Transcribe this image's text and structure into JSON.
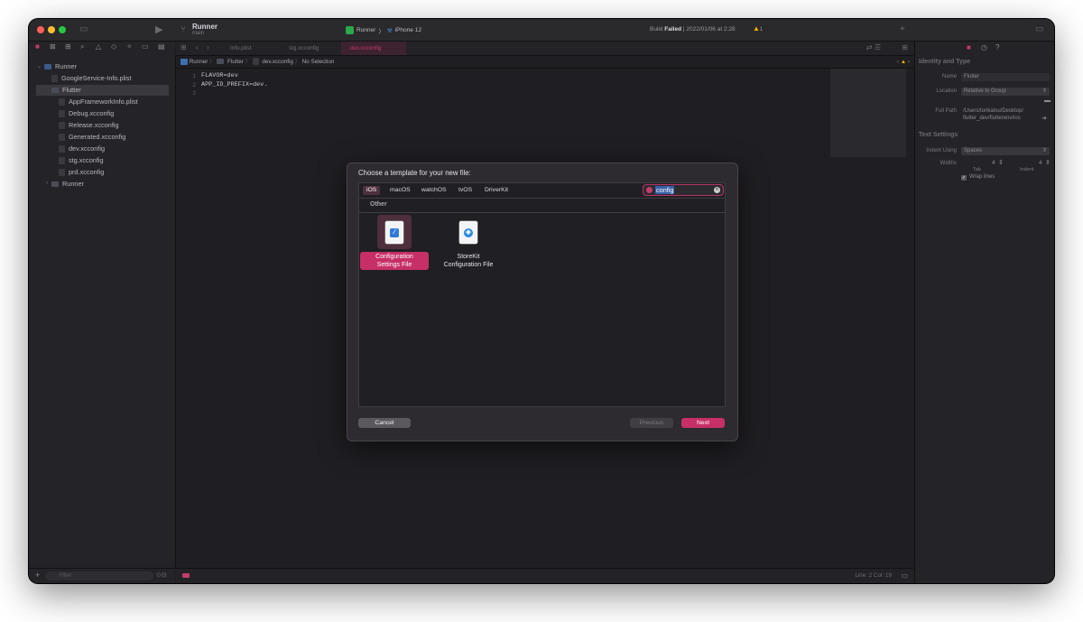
{
  "window": {
    "project_title": "Runner",
    "project_subtitle": "main",
    "scheme_target": "Runner",
    "device": "iPhone 12",
    "build_status_prefix": "Build",
    "build_status_bold": "Failed",
    "build_status_suffix": "| 2022/01/06 at 2:28",
    "warnings_count": "1"
  },
  "navigator": {
    "items": [
      {
        "label": "Runner",
        "kind": "project"
      },
      {
        "label": "GoogleService-Info.plist",
        "kind": "file"
      },
      {
        "label": "Flutter",
        "kind": "folder"
      },
      {
        "label": "AppFrameworkInfo.plist",
        "kind": "file"
      },
      {
        "label": "Debug.xcconfig",
        "kind": "file"
      },
      {
        "label": "Release.xcconfig",
        "kind": "file"
      },
      {
        "label": "Generated.xcconfig",
        "kind": "file"
      },
      {
        "label": "dev.xcconfig",
        "kind": "file"
      },
      {
        "label": "stg.xcconfig",
        "kind": "file"
      },
      {
        "label": "prd.xcconfig",
        "kind": "file"
      },
      {
        "label": "Runner",
        "kind": "folder"
      }
    ],
    "filter_placeholder": "Filter"
  },
  "editor": {
    "tabs": [
      "Info.plist",
      "stg.xcconfig",
      "dev.xcconfig"
    ],
    "breadcrumb": [
      "Runner",
      "Flutter",
      "dev.xcconfig",
      "No Selection"
    ],
    "line_numbers": [
      "1",
      "2",
      "3"
    ],
    "lines": [
      "FLAVOR=dev",
      "APP_ID_PREFIX=dev.",
      ""
    ],
    "status": "Line: 2  Col: 19"
  },
  "inspector": {
    "identity_header": "Identity and Type",
    "name_label": "Name",
    "name_value": "Flutter",
    "location_label": "Location",
    "location_value": "Relative to Group",
    "fullpath_label": "Full Path",
    "fullpath_value_1": "/Users/torikatsu/Desktop/",
    "fullpath_value_2": "flutter_dev/flutterenv/ios",
    "text_settings_header": "Text Settings",
    "indent_using_label": "Indent Using",
    "indent_using_value": "Spaces",
    "widths_label": "Widths",
    "tab_value": "4",
    "indent_value": "4",
    "tab_label": "Tab",
    "indent_label": "Indent",
    "wrap_lines_label": "Wrap lines"
  },
  "dialog": {
    "title": "Choose a template for your new file:",
    "platforms": [
      "iOS",
      "macOS",
      "watchOS",
      "tvOS",
      "DriverKit"
    ],
    "search_value": "config",
    "section_label": "Other",
    "templates": [
      {
        "label_line1": "Configuration",
        "label_line2": "Settings File",
        "icon": "config-file-icon",
        "selected": true
      },
      {
        "label_line1": "StoreKit",
        "label_line2": "Configuration File",
        "icon": "storekit-file-icon",
        "selected": false
      }
    ],
    "cancel_label": "Cancel",
    "previous_label": "Previous",
    "next_label": "Next"
  },
  "colors": {
    "accent": "#c72f68",
    "window_bg": "#1f1e22",
    "dialog_bg": "#2d2b2f"
  }
}
